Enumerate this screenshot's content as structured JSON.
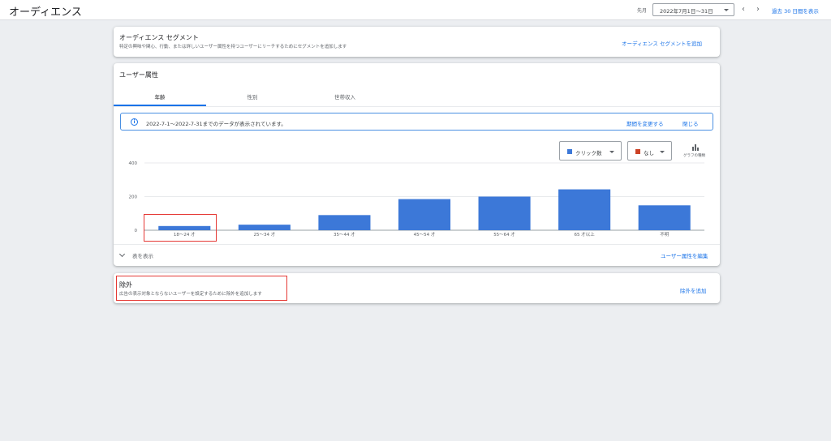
{
  "header": {
    "title": "オーディエンス",
    "period_label": "先月",
    "date_range": "2022年7月1日〜31日",
    "prev_icon": "chevron-left-icon",
    "next_icon": "chevron-right-icon",
    "last30_link": "過去 30 日間を表示"
  },
  "segment_card": {
    "title": "オーディエンス セグメント",
    "subtitle": "特定の興味や関心、行動、または詳しいユーザー属性を持つユーザーにリーチするためにセグメントを追加します",
    "add_link": "オーディエンス セグメントを追加"
  },
  "attributes_card": {
    "title": "ユーザー属性",
    "tabs": [
      {
        "label": "年齢",
        "active": true
      },
      {
        "label": "性別",
        "active": false
      },
      {
        "label": "世帯収入",
        "active": false
      }
    ],
    "banner": {
      "icon": "info-icon",
      "text": "2022-7-1〜2022-7-31までのデータが表示されています。",
      "change_period": "期間を変更する",
      "close": "閉じる"
    },
    "metric1": {
      "label": "クリック数",
      "color": "#3c78d8"
    },
    "metric2": {
      "label": "なし",
      "color": "#cc4125"
    },
    "chart_type_label": "グラフの種類",
    "show_table": "表を表示",
    "edit_link": "ユーザー属性を編集"
  },
  "chart_data": {
    "type": "bar",
    "categories": [
      "18〜24 才",
      "25〜34 才",
      "35〜44 才",
      "45〜54 才",
      "55〜64 才",
      "65 才以上",
      "不明"
    ],
    "series": [
      {
        "name": "クリック数",
        "values": [
          25,
          33,
          90,
          185,
          200,
          243,
          148
        ]
      }
    ],
    "yticks": [
      "400",
      "200",
      "0"
    ],
    "ylim": [
      0,
      400
    ],
    "grid": true,
    "color": "#3c78d8"
  },
  "exclusion_card": {
    "title": "除外",
    "subtitle": "広告の表示対象とならないユーザーを設定するために除外を追加します",
    "add_link": "除外を追加"
  }
}
